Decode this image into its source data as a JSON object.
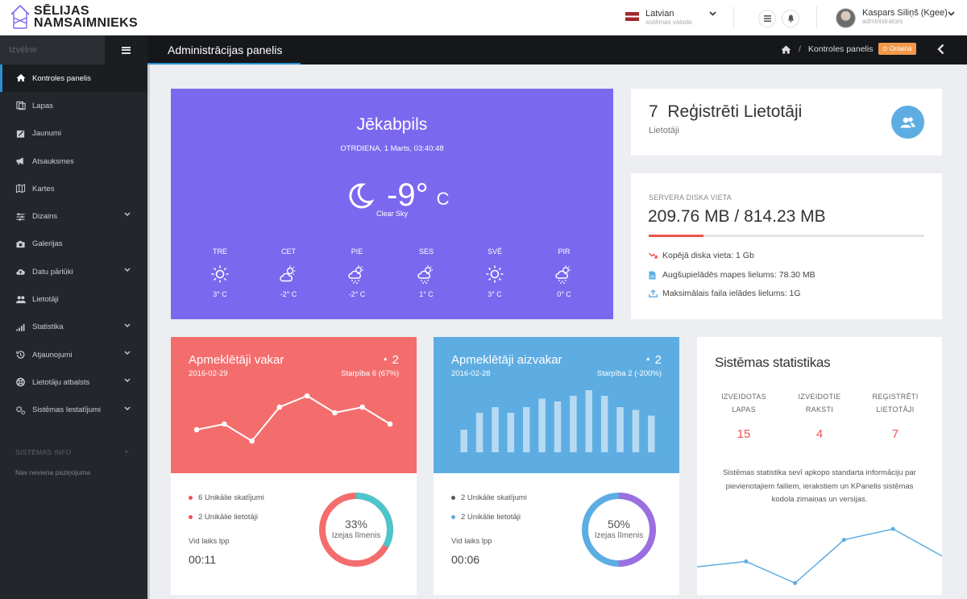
{
  "header": {
    "logo_line1": "SĒLIJAS",
    "logo_line2": "NAMSAIMNIEKS",
    "language": {
      "name": "Latvian",
      "sub": "sistēmas valoda"
    },
    "user": {
      "name": "Kaspars Siliņš (Kgee)",
      "role": "administrators"
    }
  },
  "sidebar": {
    "search_placeholder": "Izvēlne",
    "items": [
      {
        "label": "Kontroles panelis",
        "icon": "home-icon",
        "active": true,
        "chevron": false
      },
      {
        "label": "Lapas",
        "icon": "pages-icon",
        "chevron": false
      },
      {
        "label": "Jaunumi",
        "icon": "edit-icon",
        "chevron": false
      },
      {
        "label": "Atsauksmes",
        "icon": "megaphone-icon",
        "chevron": false
      },
      {
        "label": "Kartes",
        "icon": "map-icon",
        "chevron": false
      },
      {
        "label": "Dizains",
        "icon": "sliders-icon",
        "chevron": true
      },
      {
        "label": "Galerijas",
        "icon": "camera-icon",
        "chevron": false
      },
      {
        "label": "Datu pārlūki",
        "icon": "cloud-upload-icon",
        "chevron": true
      },
      {
        "label": "Lietotāji",
        "icon": "users-icon",
        "chevron": false
      },
      {
        "label": "Statistika",
        "icon": "signal-icon",
        "chevron": true
      },
      {
        "label": "Atjaunojumi",
        "icon": "history-icon",
        "chevron": true
      },
      {
        "label": "Lietotāju atbalsts",
        "icon": "lifebuoy-icon",
        "chevron": true
      },
      {
        "label": "Sistēmas Iestatījumi",
        "icon": "cogs-icon",
        "chevron": true
      }
    ],
    "info_title": "SISTĒMAS INFO",
    "info_close": "×",
    "info_text": "Nav neviena paziņojuma"
  },
  "titlebar": {
    "title": "Administrācijas panelis",
    "breadcrumb_sep": "/",
    "breadcrumb": "Kontroles panelis",
    "status_badge": "Onlainā"
  },
  "weather": {
    "city": "Jēkabpils",
    "date": "OTRDIENA,  1 Marts, 03:40:48",
    "temp": "-9°",
    "unit": "C",
    "condition": "Clear Sky",
    "forecast": [
      {
        "day": "TRE",
        "temp": "3° C",
        "icon": "sun-icon"
      },
      {
        "day": "CET",
        "temp": "-2° C",
        "icon": "partly-cloudy-icon"
      },
      {
        "day": "PIE",
        "temp": "-2° C",
        "icon": "snow-cloud-icon"
      },
      {
        "day": "SES",
        "temp": "1° C",
        "icon": "snow-cloud-icon"
      },
      {
        "day": "SVĒ",
        "temp": "3° C",
        "icon": "sun-icon"
      },
      {
        "day": "PIR",
        "temp": "0° C",
        "icon": "snow-cloud-icon"
      }
    ]
  },
  "registered_users": {
    "count": "7",
    "title": "Reģistrēti Lietotāji",
    "sub": "Lietotāji"
  },
  "disk": {
    "title": "SERVERA DISKA VIETA",
    "value": "209.76 MB / 814.23 MB",
    "used_fraction": 0.2,
    "lines": [
      "Kopējā diska vieta: 1 Gb",
      "Augšupielādēs mapes lielums: 78.30 MB",
      "Maksimālais faila ielādes lielums: 1G"
    ]
  },
  "visitors_yesterday": {
    "title": "Apmeklētāji vakar",
    "date": "2016-02-29",
    "arrow": "▲",
    "count": "2",
    "diff": "Starpība 6 (67%)",
    "color": "#f46d6d",
    "legend": [
      {
        "text": "6 Unikālie skatījumi",
        "color": "#ef5350"
      },
      {
        "text": "2 Unikālie lietotāji",
        "color": "#ef5350"
      }
    ],
    "avg_label": "Vid laiks lpp",
    "avg_value": "00:11",
    "percent": "33%",
    "percent_value": 33,
    "percent_label": "Izejas līmenis",
    "ring_colors": [
      "#4ec4cc",
      "#f46d6d"
    ]
  },
  "visitors_daybefore": {
    "title": "Apmeklētāji aizvakar",
    "date": "2016-02-28",
    "arrow": "▲",
    "count": "2",
    "diff": "Starpība 2 (-200%)",
    "color": "#5dade2",
    "legend": [
      {
        "text": "2 Unikālie skatījumi",
        "color": "#555555"
      },
      {
        "text": "2 Unikālie lietotāji",
        "color": "#5dade2"
      }
    ],
    "avg_label": "Vid laiks lpp",
    "avg_value": "00:06",
    "percent": "50%",
    "percent_value": 50,
    "percent_label": "Izejas līmenis",
    "ring_colors": [
      "#9b6fe0",
      "#5dade2"
    ]
  },
  "system_stats": {
    "title": "Sistēmas statistikas",
    "columns": [
      {
        "label": "IZVEIDOTAS\nLAPAS",
        "value": "15"
      },
      {
        "label": "IZVEIDOTIE\nRAKSTI",
        "value": "4"
      },
      {
        "label": "REĢISTRĒTI\nLIETOTĀJI",
        "value": "7"
      }
    ],
    "text": "Sistēmas statistika sevī apkopo standarta informāciju par pievienotajiem failiem, ierakstiem un KPanelis sistēmas kodola zimaiņas un versijas."
  },
  "chart_data": [
    {
      "type": "line",
      "x": [
        1,
        2,
        3,
        4,
        5,
        6,
        7,
        8
      ],
      "values": [
        4,
        5,
        2,
        8,
        10,
        7,
        8,
        5
      ],
      "ylim": [
        0,
        12
      ]
    },
    {
      "type": "bar",
      "x": [
        1,
        2,
        3,
        4,
        5,
        6,
        7,
        8,
        9,
        10,
        11,
        12,
        13
      ],
      "values": [
        4,
        7,
        8,
        7,
        8,
        9.5,
        9,
        10,
        11,
        10,
        8,
        7.5,
        6.5
      ],
      "ylim": [
        0,
        12
      ]
    },
    {
      "type": "line",
      "x": [
        1,
        2,
        3,
        4,
        5,
        6
      ],
      "values": [
        4,
        5,
        1,
        9,
        11,
        6
      ],
      "ylim": [
        0,
        14
      ]
    }
  ]
}
